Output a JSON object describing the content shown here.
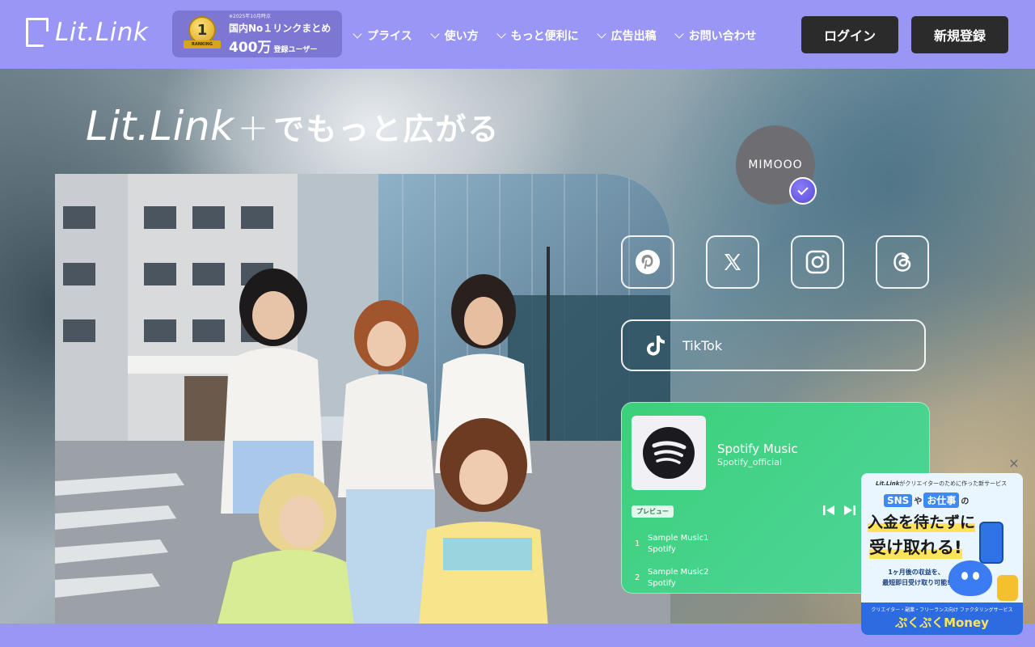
{
  "header": {
    "logo_text": "Lit.Link",
    "badge": {
      "note": "※2025年10月時点",
      "title": "国内No１リンクまとめ",
      "count": "400万",
      "count_suffix": "登録ユーザー",
      "medal_number": "1",
      "medal_ribbon": "RANKING"
    },
    "nav": [
      {
        "label": "プライス"
      },
      {
        "label": "使い方"
      },
      {
        "label": "もっと便利に"
      },
      {
        "label": "広告出稿"
      },
      {
        "label": "お問い合わせ"
      }
    ],
    "login_label": "ログイン",
    "signup_label": "新規登録"
  },
  "hero": {
    "brand": "Lit.Link",
    "plus": "+",
    "tagline": "でもっと広がる"
  },
  "profile": {
    "avatar_text": "MIMOOO",
    "socials": [
      {
        "icon": "pinterest-icon"
      },
      {
        "icon": "x-icon"
      },
      {
        "icon": "instagram-icon"
      },
      {
        "icon": "threads-icon"
      }
    ],
    "tiktok_label": "TikTok"
  },
  "spotify": {
    "title": "Spotify Music",
    "subtitle": "Spotify_official",
    "preview_label": "プレビュー",
    "tracks": [
      {
        "num": "1",
        "name": "Sample Music1",
        "artist": "Spotify"
      },
      {
        "num": "2",
        "name": "Sample Music2",
        "artist": "Spotify"
      }
    ]
  },
  "ad": {
    "close": "×",
    "top_brand": "Lit.Link",
    "top_text": "がクリエイターのために作った新サービス",
    "sns_chip": "SNS",
    "sns_ya": "や",
    "work_chip": "お仕事",
    "no": "の",
    "head1": "入金を待たずに",
    "head2": "受け取れる!",
    "desc1": "1ヶ月後の収益を、",
    "desc2": "最短即日受け取り可能!",
    "bottom_note": "クリエイター・副業・フリーランス向け ファクタリングサービス",
    "bottom_brand": "ぷくぷくMoney"
  },
  "colors": {
    "header_bg": "#9a96f6",
    "button_dark": "#2b2b2b",
    "spotify_green": "#3cd07a",
    "verified_purple": "#6b5ce8"
  }
}
